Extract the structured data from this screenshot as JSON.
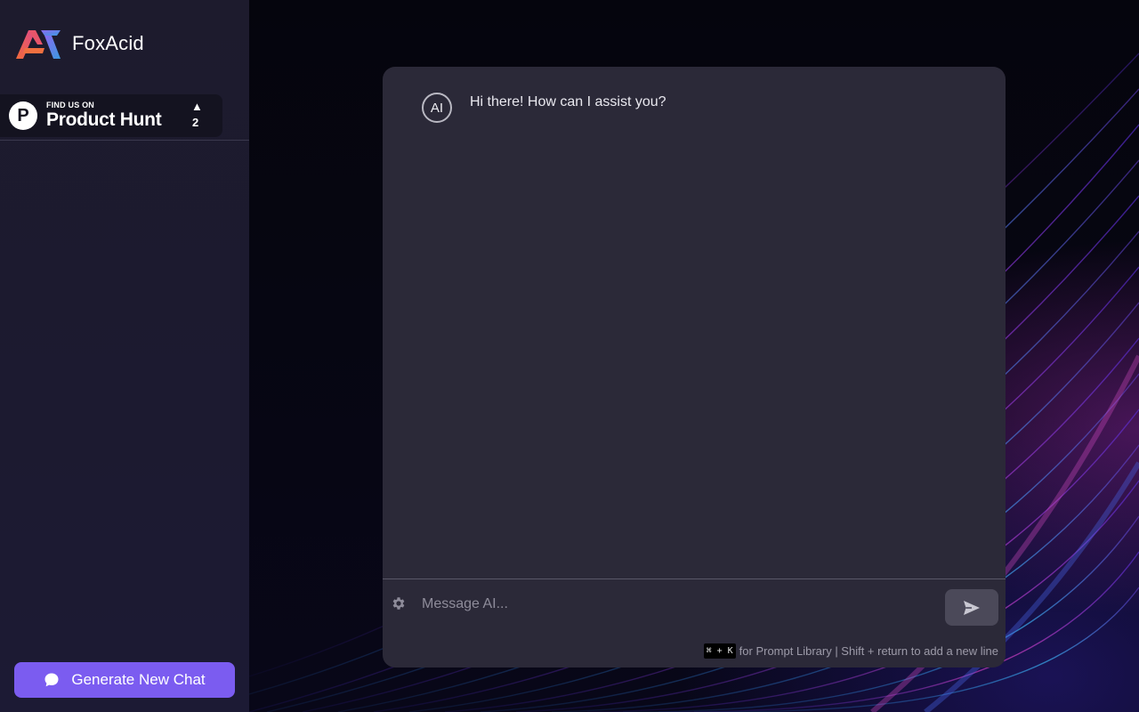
{
  "app": {
    "name": "FoxAcid"
  },
  "sidebar": {
    "product_hunt": {
      "small_text": "FIND US ON",
      "big_text": "Product Hunt",
      "letter": "P",
      "arrow": "▲",
      "count": "2"
    },
    "new_chat_label": "Generate New Chat"
  },
  "chat": {
    "avatar_label": "AI",
    "messages": [
      {
        "sender": "AI",
        "text": "Hi there! How can I assist you?"
      }
    ],
    "input_placeholder": "Message AI...",
    "input_value": "",
    "hint": {
      "shortcut": "⌘ + K",
      "text": "for Prompt Library | Shift + return to add a new line"
    }
  },
  "icons": {
    "settings": "gear-icon",
    "send": "send-icon",
    "new_chat": "chat-bubble-icon",
    "logo": "foxacid-logo-icon"
  },
  "colors": {
    "accent": "#7b5cf0",
    "panel": "#2b2938",
    "sidebar": "#1d1b2d"
  }
}
